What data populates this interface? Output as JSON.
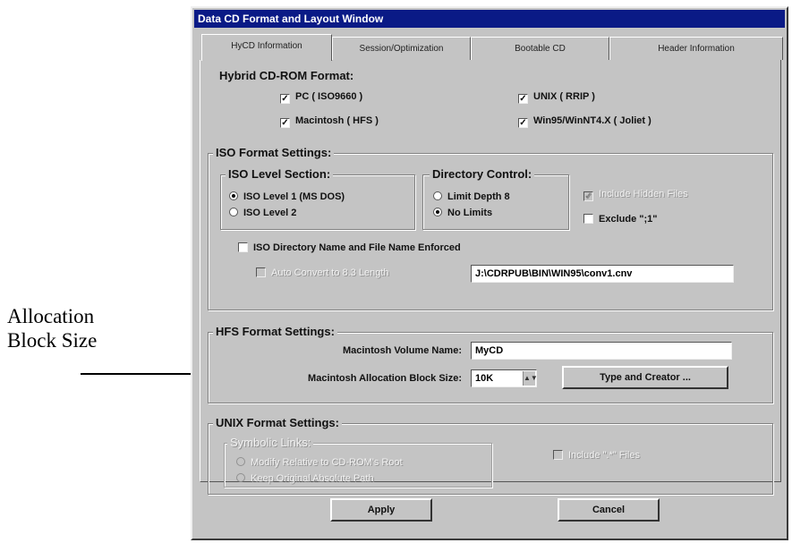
{
  "annotation": {
    "line1": "Allocation",
    "line2": "Block Size"
  },
  "window": {
    "title": "Data CD Format and Layout Window"
  },
  "tabs": [
    "HyCD Information",
    "Session/Optimization",
    "Bootable CD",
    "Header Information"
  ],
  "hybrid": {
    "title": "Hybrid CD-ROM Format:",
    "pc": "PC ( ISO9660 )",
    "unix": "UNIX ( RRIP )",
    "mac": "Macintosh ( HFS )",
    "win": "Win95/WinNT4.X ( Joliet )"
  },
  "iso": {
    "title": "ISO Format Settings:",
    "level_title": "ISO Level Section:",
    "level1": "ISO Level 1 (MS DOS)",
    "level2": "ISO Level 2",
    "dir_title": "Directory Control:",
    "limit8": "Limit Depth 8",
    "nolimits": "No Limits",
    "include_hidden": "Include Hidden Files",
    "exclude": "Exclude \";1\"",
    "enforced": "ISO Directory Name and File Name Enforced",
    "auto_convert": "Auto Convert to 8.3 Length",
    "path_value": "J:\\CDRPUB\\BIN\\WIN95\\conv1.cnv"
  },
  "hfs": {
    "title": "HFS Format Settings:",
    "volume_label": "Macintosh Volume Name:",
    "volume_value": "MyCD",
    "block_label": "Macintosh Allocation Block Size:",
    "block_value": "10K",
    "type_creator": "Type and Creator ..."
  },
  "unix": {
    "title": "UNIX Format Settings:",
    "symlinks_title": "Symbolic Links:",
    "modify": "Modify Relative to CD-ROM's Root",
    "keep": "Keep Original Absolute Path",
    "include_files": "Include \".*\" Files"
  },
  "buttons": {
    "apply": "Apply",
    "cancel": "Cancel"
  }
}
